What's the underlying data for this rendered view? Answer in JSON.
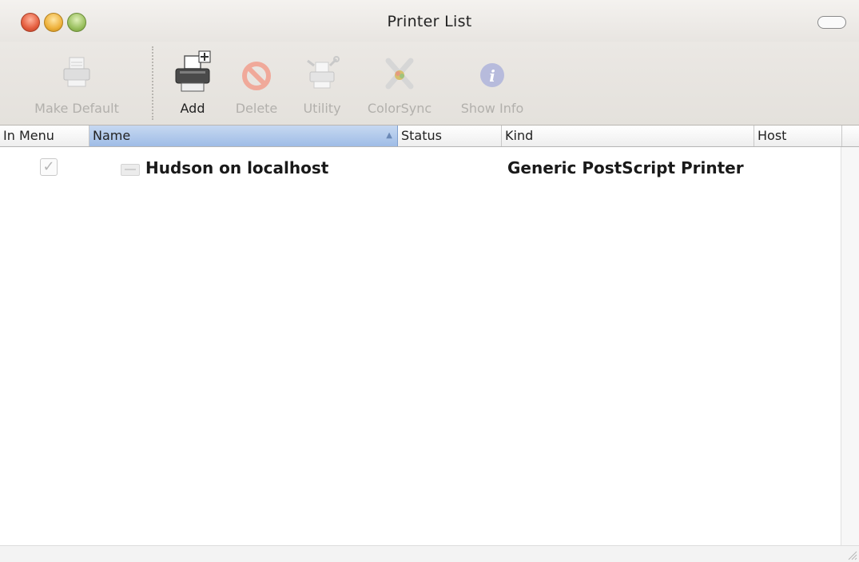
{
  "window": {
    "title": "Printer List"
  },
  "toolbar": {
    "items": [
      {
        "label": "Make Default",
        "enabled": false,
        "icon": "printer-icon"
      },
      {
        "label": "Add",
        "enabled": true,
        "icon": "add-printer-icon"
      },
      {
        "label": "Delete",
        "enabled": false,
        "icon": "delete-icon"
      },
      {
        "label": "Utility",
        "enabled": false,
        "icon": "utility-icon"
      },
      {
        "label": "ColorSync",
        "enabled": false,
        "icon": "colorsync-icon"
      },
      {
        "label": "Show Info",
        "enabled": false,
        "icon": "info-icon"
      }
    ]
  },
  "table": {
    "columns": [
      "In Menu",
      "Name",
      "Status",
      "Kind",
      "Host"
    ],
    "sorted_column": "Name",
    "rows": [
      {
        "in_menu": true,
        "name": "Hudson on localhost",
        "status": "",
        "kind": "Generic PostScript Printer",
        "host": ""
      }
    ]
  },
  "colors": {
    "close": "#e45d3e",
    "minimize": "#eeb13b",
    "zoom": "#9ac05f",
    "sort_header": "#a9c3e9"
  }
}
